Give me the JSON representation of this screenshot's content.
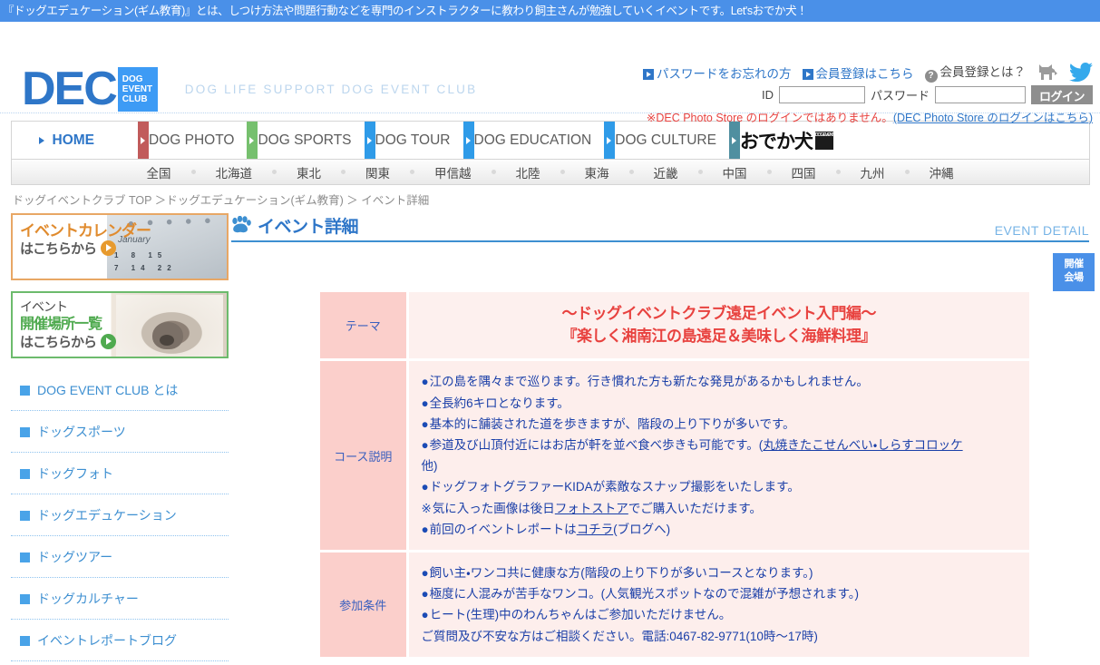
{
  "top_banner": {
    "text": "『ドッグエデュケーション(ギム教育)』とは、しつけ方法や問題行動などを専門のインストラクターに教わり飼主さんが勉強していくイベントです。Let'sおでか犬！"
  },
  "header": {
    "logo_text": "DEC",
    "logo_badge_line1": "DOG",
    "logo_badge_line2": "EVENT",
    "logo_badge_line3": "CLUB",
    "tagline": "DOG LIFE SUPPORT DOG EVENT CLUB",
    "links": [
      {
        "label": "パスワードをお忘れの方",
        "icon": "blue-arrow-icon"
      },
      {
        "label": "会員登録はこちら",
        "icon": "blue-arrow-icon"
      },
      {
        "label": "会員登録とは？",
        "icon": "question-mark-icon"
      }
    ],
    "social": [
      {
        "name": "dog-icon"
      },
      {
        "name": "twitter-bird-icon"
      }
    ],
    "login": {
      "id_label": "ID",
      "id_value": "",
      "id_placeholder": "",
      "password_label": "パスワード",
      "password_value": "",
      "password_placeholder": "",
      "button_label": "ログイン"
    },
    "store_note_prefix": "※DEC Photo Store のログインではありません。",
    "store_note_link": "(DEC Photo Store のログインはこちら)"
  },
  "main_nav": [
    {
      "label": "HOME",
      "tab_color": "",
      "active": true
    },
    {
      "label": "DOG PHOTO",
      "tab_color": "#c15b5b",
      "active": false
    },
    {
      "label": "DOG SPORTS",
      "tab_color": "#76c06e",
      "active": false
    },
    {
      "label": "DOG TOUR",
      "tab_color": "#2f9be8",
      "active": false
    },
    {
      "label": "DOG EDUCATION",
      "tab_color": "#2f9be8",
      "active": false
    },
    {
      "label": "DOG CULTURE",
      "tab_color": "#2f9be8",
      "active": false
    },
    {
      "label": "おでか犬",
      "tab_color": "#4f8fa0",
      "active": false,
      "is_logo": true
    }
  ],
  "odeka_mini": "DOG EVENT CLUB",
  "region_nav": [
    "全国",
    "北海道",
    "東北",
    "関東",
    "甲信越",
    "北陸",
    "東海",
    "近畿",
    "中国",
    "四国",
    "九州",
    "沖縄"
  ],
  "breadcrumb": "ドッグイベントクラブ TOP ＞ドッグエデュケーション(ギム教育) ＞ イベント詳細",
  "sidebar": {
    "banners": [
      {
        "line1": "イベントカレンダー",
        "line2": "はこちらから",
        "art": "calendar-photo",
        "cal_month": "January",
        "cal_nums": "1  8  15",
        "cal_nums2": "7 14 22"
      },
      {
        "line0": "イベント",
        "line1": "開催場所一覧",
        "line2": "はこちらから",
        "art": "dog-photo"
      }
    ],
    "links": [
      "DOG EVENT CLUB とは",
      "ドッグスポーツ",
      "ドッグフォト",
      "ドッグエデュケーション",
      "ドッグツアー",
      "ドッグカルチャー",
      "イベントレポートブログ"
    ]
  },
  "main": {
    "page_title": "イベント詳細",
    "page_title_en": "EVENT DETAIL",
    "paw_icon": "paw-print-icon",
    "venue_button": {
      "line1": "開催",
      "line2": "会場"
    },
    "table": {
      "rows": [
        {
          "header": "テーマ",
          "type": "theme",
          "lines": [
            "～ドッグイベントクラブ遠足イベント入門編～",
            "『楽しく湘南江の島遠足＆美味しく海鮮料理』"
          ]
        },
        {
          "header": "コース説明",
          "type": "list",
          "lines": [
            {
              "bullet": "●",
              "text": "江の島を隅々まで巡ります。行き慣れた方も新たな発見があるかもしれません。"
            },
            {
              "bullet": "●",
              "text": "全長約6キロとなります。"
            },
            {
              "bullet": "●",
              "text": "基本的に舗装された道を歩きますが、階段の上り下りが多いです。"
            },
            {
              "bullet": "●",
              "text": "参道及び山頂付近にはお店が軒を並べ食べ歩きも可能です。(",
              "link": "丸焼きたこせんべい・しらすコロッケ",
              "suffix": ""
            },
            {
              "bullet": "",
              "text": "他)"
            },
            {
              "bullet": "●",
              "text": "ドッグフォトグラファーKIDAが素敵なスナップ撮影をいたします。"
            },
            {
              "bullet": "※",
              "text": "気に入った画像は後日",
              "link": "フォトストア",
              "suffix": "でご購入いただけます。"
            },
            {
              "bullet": "●",
              "text": "前回のイベントレポートは",
              "link": "コチラ",
              "suffix": "(ブログへ)"
            }
          ]
        },
        {
          "header": "参加条件",
          "type": "list",
          "lines": [
            {
              "bullet": "●",
              "text": "飼い主・ワンコ共に健康な方(階段の上り下りが多いコースとなります。)"
            },
            {
              "bullet": "●",
              "text": "極度に人混みが苦手なワンコ。(人気観光スポットなので混雑が予想されます。)"
            },
            {
              "bullet": "●",
              "text": "ヒート(生理)中のわんちゃんはご参加いただけません。"
            },
            {
              "bullet": "",
              "text": "ご質問及び不安な方はご相談ください。電話:0467-82-9771(10時～17時)"
            }
          ]
        }
      ]
    }
  },
  "colors": {
    "banner_blue": "#4a90e8",
    "brand_blue": "#2e76c8",
    "accent_red": "#e8423f",
    "table_header_pink": "#fbcfcb",
    "table_body_pink": "#fdeeec",
    "link_blue": "#1a3fa8"
  }
}
